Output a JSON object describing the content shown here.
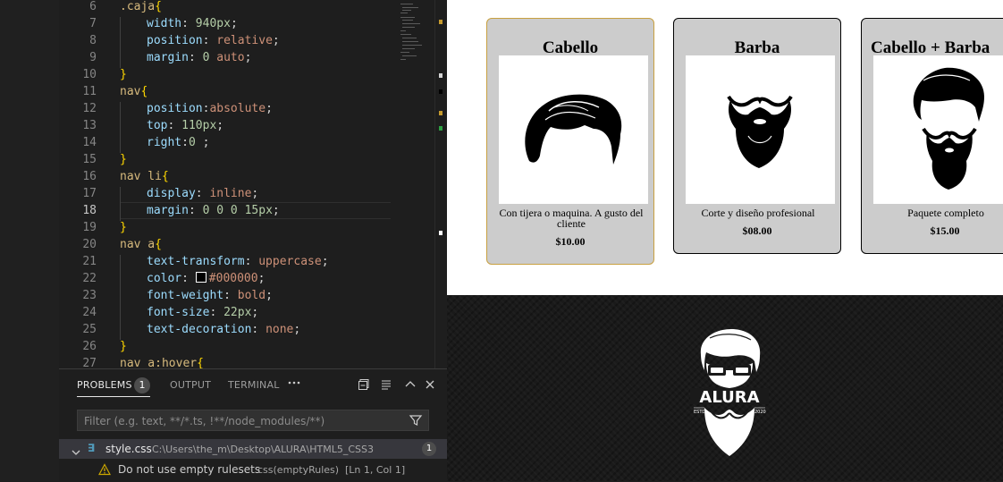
{
  "editor": {
    "lines": [
      {
        "n": "6",
        "indent": 0,
        "tokens": [
          {
            "t": ".caja",
            "c": "sel"
          },
          {
            "t": "{",
            "c": "brace"
          }
        ]
      },
      {
        "n": "7",
        "indent": 1,
        "tokens": [
          {
            "t": "width",
            "c": "prop"
          },
          {
            "t": ": ",
            "c": "punc"
          },
          {
            "t": "940px",
            "c": "num"
          },
          {
            "t": ";",
            "c": "punc"
          }
        ]
      },
      {
        "n": "8",
        "indent": 1,
        "tokens": [
          {
            "t": "position",
            "c": "prop"
          },
          {
            "t": ": ",
            "c": "punc"
          },
          {
            "t": "relative",
            "c": "val"
          },
          {
            "t": ";",
            "c": "punc"
          }
        ]
      },
      {
        "n": "9",
        "indent": 1,
        "tokens": [
          {
            "t": "margin",
            "c": "prop"
          },
          {
            "t": ": ",
            "c": "punc"
          },
          {
            "t": "0",
            "c": "num"
          },
          {
            "t": " ",
            "c": "punc"
          },
          {
            "t": "auto",
            "c": "val"
          },
          {
            "t": ";",
            "c": "punc"
          }
        ]
      },
      {
        "n": "10",
        "indent": 0,
        "tokens": [
          {
            "t": "}",
            "c": "brace"
          }
        ]
      },
      {
        "n": "11",
        "indent": 0,
        "tokens": [
          {
            "t": "nav",
            "c": "sel"
          },
          {
            "t": "{",
            "c": "brace"
          }
        ]
      },
      {
        "n": "12",
        "indent": 1,
        "tokens": [
          {
            "t": "position",
            "c": "prop"
          },
          {
            "t": ":",
            "c": "punc"
          },
          {
            "t": "absolute",
            "c": "val"
          },
          {
            "t": ";",
            "c": "punc"
          }
        ]
      },
      {
        "n": "13",
        "indent": 1,
        "tokens": [
          {
            "t": "top",
            "c": "prop"
          },
          {
            "t": ": ",
            "c": "punc"
          },
          {
            "t": "110px",
            "c": "num"
          },
          {
            "t": ";",
            "c": "punc"
          }
        ]
      },
      {
        "n": "14",
        "indent": 1,
        "tokens": [
          {
            "t": "right",
            "c": "prop"
          },
          {
            "t": ":",
            "c": "punc"
          },
          {
            "t": "0",
            "c": "num"
          },
          {
            "t": " ;",
            "c": "punc"
          }
        ]
      },
      {
        "n": "15",
        "indent": 0,
        "tokens": [
          {
            "t": "}",
            "c": "brace"
          }
        ]
      },
      {
        "n": "16",
        "indent": 0,
        "tokens": [
          {
            "t": "nav li",
            "c": "sel"
          },
          {
            "t": "{",
            "c": "brace"
          }
        ]
      },
      {
        "n": "17",
        "indent": 1,
        "tokens": [
          {
            "t": "display",
            "c": "prop"
          },
          {
            "t": ": ",
            "c": "punc"
          },
          {
            "t": "inline",
            "c": "val"
          },
          {
            "t": ";",
            "c": "punc"
          }
        ]
      },
      {
        "n": "18",
        "indent": 1,
        "active": true,
        "tokens": [
          {
            "t": "margin",
            "c": "prop"
          },
          {
            "t": ": ",
            "c": "punc"
          },
          {
            "t": "0 0 0 15px",
            "c": "num"
          },
          {
            "t": ";",
            "c": "punc"
          }
        ]
      },
      {
        "n": "19",
        "indent": 0,
        "tokens": [
          {
            "t": "}",
            "c": "brace"
          }
        ]
      },
      {
        "n": "20",
        "indent": 0,
        "tokens": [
          {
            "t": "nav a",
            "c": "sel"
          },
          {
            "t": "{",
            "c": "brace"
          }
        ]
      },
      {
        "n": "21",
        "indent": 1,
        "tokens": [
          {
            "t": "text-transform",
            "c": "prop"
          },
          {
            "t": ": ",
            "c": "punc"
          },
          {
            "t": "uppercase",
            "c": "val"
          },
          {
            "t": ";",
            "c": "punc"
          }
        ]
      },
      {
        "n": "22",
        "indent": 1,
        "swatch": true,
        "tokens": [
          {
            "t": "color",
            "c": "prop"
          },
          {
            "t": ": ",
            "c": "punc"
          },
          {
            "t": "SWATCH",
            "c": "swatch"
          },
          {
            "t": "#000000",
            "c": "val"
          },
          {
            "t": ";",
            "c": "punc"
          }
        ]
      },
      {
        "n": "23",
        "indent": 1,
        "tokens": [
          {
            "t": "font-weight",
            "c": "prop"
          },
          {
            "t": ": ",
            "c": "punc"
          },
          {
            "t": "bold",
            "c": "val"
          },
          {
            "t": ";",
            "c": "punc"
          }
        ]
      },
      {
        "n": "24",
        "indent": 1,
        "tokens": [
          {
            "t": "font-size",
            "c": "prop"
          },
          {
            "t": ": ",
            "c": "punc"
          },
          {
            "t": "22px",
            "c": "num"
          },
          {
            "t": ";",
            "c": "punc"
          }
        ]
      },
      {
        "n": "25",
        "indent": 1,
        "tokens": [
          {
            "t": "text-decoration",
            "c": "prop"
          },
          {
            "t": ": ",
            "c": "punc"
          },
          {
            "t": "none",
            "c": "val"
          },
          {
            "t": ";",
            "c": "punc"
          }
        ]
      },
      {
        "n": "26",
        "indent": 0,
        "tokens": [
          {
            "t": "}",
            "c": "brace"
          }
        ]
      },
      {
        "n": "27",
        "indent": 0,
        "tokens": [
          {
            "t": "nav a:hover",
            "c": "sel"
          },
          {
            "t": "{",
            "c": "brace"
          }
        ]
      }
    ],
    "colors": {
      "selector": "#d7ba7d",
      "property": "#9cdcfe",
      "value": "#ce9178",
      "number": "#b5cea8",
      "brace": "#ffd700"
    }
  },
  "panel": {
    "tabs": [
      "PROBLEMS",
      "OUTPUT",
      "TERMINAL"
    ],
    "problems_count": "1",
    "more_icon": "ellipsis-icon",
    "actions": [
      "collapse-all-icon",
      "filter-lines-icon",
      "maximize-panel-icon",
      "close-panel-icon"
    ],
    "filter_placeholder": "Filter (e.g. text, **/*.ts, !**/node_modules/**)",
    "file": {
      "name": "style.css",
      "path": "C:\\Users\\the_m\\Desktop\\ALURA\\HTML5_CSS3",
      "count": "1"
    },
    "problem": {
      "message": "Do not use empty rulesets",
      "source": "css(emptyRules)",
      "location": "[Ln 1, Col 1]"
    }
  },
  "preview": {
    "cards": [
      {
        "title": "Cabello",
        "desc": "Con tijera o maquina. A gusto del cliente",
        "price": "$10.00",
        "image": "hair-icon"
      },
      {
        "title": "Barba",
        "desc": "Corte y diseño profesional",
        "price": "$08.00",
        "image": "beard-icon"
      },
      {
        "title": "Cabello + Barba",
        "desc": "Paquete completo",
        "price": "$15.00",
        "image": "hair-and-beard-icon"
      }
    ],
    "logo": {
      "text": "ALURA",
      "left": "ESTD",
      "right": "2020"
    },
    "colors": {
      "card_bg": "#cccccc",
      "hover_border": "#c8a040",
      "footer_bg": "#1a1a1a"
    }
  }
}
